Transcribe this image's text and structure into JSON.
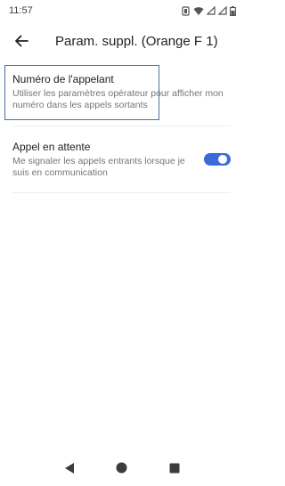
{
  "status_bar": {
    "time": "11:57",
    "icons": [
      "vibrate-icon",
      "wifi-icon",
      "signal-icon",
      "signal-icon",
      "battery-icon"
    ]
  },
  "app_bar": {
    "back_icon": "arrow-back-icon",
    "title": "Param. suppl. (Orange F 1)"
  },
  "settings": [
    {
      "title": "Numéro de l'appelant",
      "summary": "Utiliser les paramètres opérateur pour afficher mon numéro dans les appels sortants"
    },
    {
      "title": "Appel en attente",
      "summary": "Me signaler les appels entrants lorsque je suis en communication",
      "switch_on": true
    }
  ],
  "nav_bar": {
    "icons": [
      "nav-back-icon",
      "nav-home-icon",
      "nav-recents-icon"
    ]
  },
  "colors": {
    "accent": "#3b6bd9",
    "focus_outline": "#4a6fa5"
  }
}
